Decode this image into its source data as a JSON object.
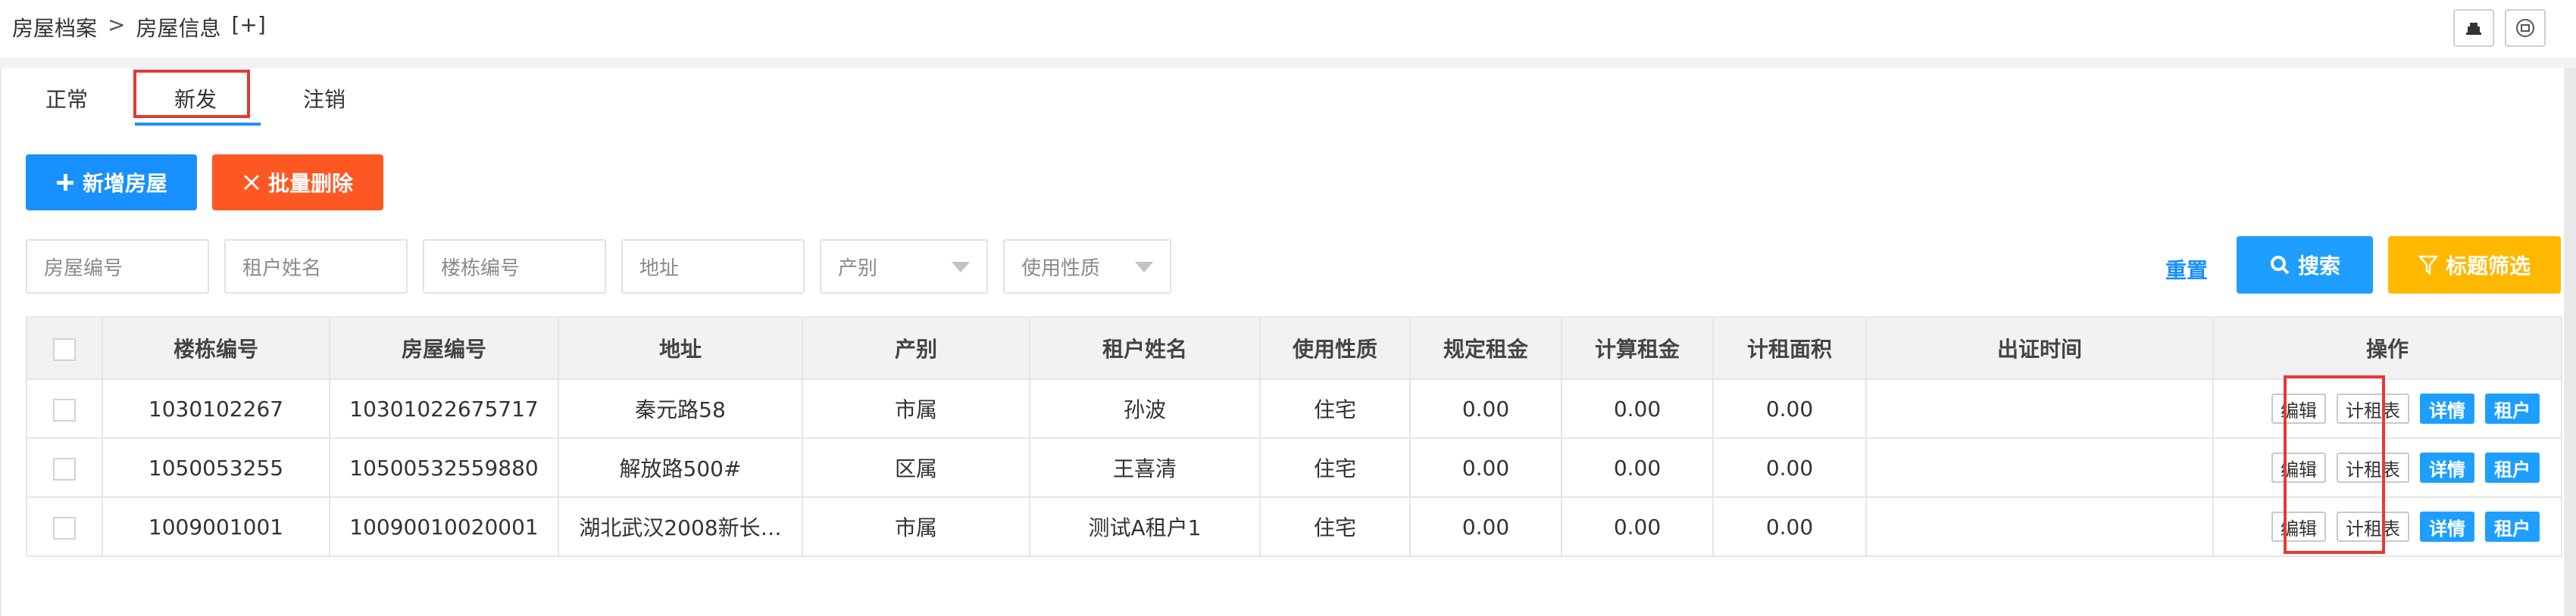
{
  "breadcrumb": {
    "root": "房屋档案",
    "separator": ">",
    "current": "房屋信息",
    "add": "[+]"
  },
  "tabs": [
    {
      "label": "正常"
    },
    {
      "label": "新发"
    },
    {
      "label": "注销"
    }
  ],
  "active_tab": "新发",
  "toolbar": {
    "add_label": "新增房屋",
    "batch_delete_label": "批量删除"
  },
  "filters": {
    "house_no_placeholder": "房屋编号",
    "tenant_name_placeholder": "租户姓名",
    "building_no_placeholder": "楼栋编号",
    "address_placeholder": "地址",
    "property_select": "产别",
    "usage_select": "使用性质",
    "reset_label": "重置",
    "search_label": "搜索",
    "filter_label": "标题筛选"
  },
  "table": {
    "headers": [
      "楼栋编号",
      "房屋编号",
      "地址",
      "产别",
      "租户姓名",
      "使用性质",
      "规定租金",
      "计算租金",
      "计租面积",
      "出证时间",
      "操作"
    ],
    "rows": [
      {
        "building": "1030102267",
        "house": "10301022675717",
        "address": "秦元路58",
        "property": "市属",
        "tenant": "孙波",
        "usage": "住宅",
        "set_rent": "0.00",
        "calc_rent": "0.00",
        "area": "0.00",
        "cert_time": ""
      },
      {
        "building": "1050053255",
        "house": "10500532559880",
        "address": "解放路500#",
        "property": "区属",
        "tenant": "王喜清",
        "usage": "住宅",
        "set_rent": "0.00",
        "calc_rent": "0.00",
        "area": "0.00",
        "cert_time": ""
      },
      {
        "building": "1009001001",
        "house": "10090010020001",
        "address": "湖北武汉2008新长…",
        "property": "市属",
        "tenant": "测试A租户1",
        "usage": "住宅",
        "set_rent": "0.00",
        "calc_rent": "0.00",
        "area": "0.00",
        "cert_time": ""
      }
    ],
    "actions": {
      "edit": "编辑",
      "rent_table": "计租表",
      "detail": "详情",
      "tenant": "租户"
    }
  },
  "colors": {
    "primary": "#1890ff",
    "danger": "#ff5722",
    "warning": "#ffb800",
    "highlight": "#e53935"
  },
  "icons": [
    "printer-icon",
    "print-icon",
    "plus-icon",
    "close-icon",
    "search-icon",
    "filter-icon"
  ]
}
